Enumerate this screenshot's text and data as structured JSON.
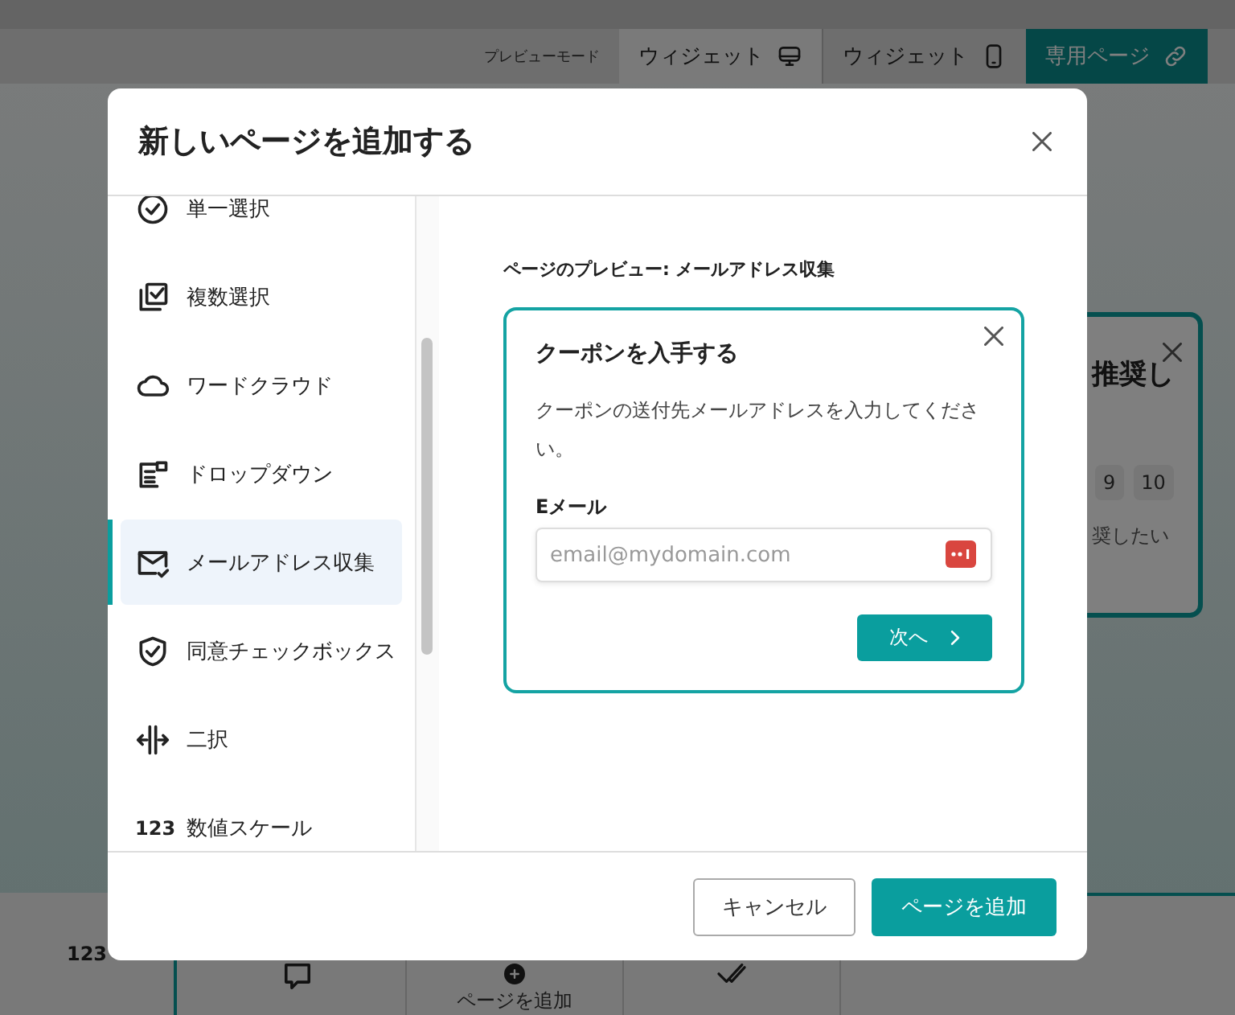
{
  "preview_mode": {
    "label": "プレビューモード",
    "tabs": [
      {
        "label": "ウィジェット",
        "selected": false
      },
      {
        "label": "ウィジェット",
        "selected": false
      },
      {
        "label": "専用ページ",
        "selected": true
      }
    ]
  },
  "background_card": {
    "title": "推奨し",
    "scale": [
      "9",
      "10"
    ],
    "caption": "奨したい"
  },
  "background_footer": {
    "number_icon": "123",
    "add_page_label": "ページを追加"
  },
  "dialog": {
    "title": "新しいページを追加する",
    "page_types": [
      {
        "label": "単一選択",
        "kind": "single",
        "selected": false
      },
      {
        "label": "複数選択",
        "kind": "multiple",
        "selected": false
      },
      {
        "label": "ワードクラウド",
        "kind": "cloud",
        "selected": false
      },
      {
        "label": "ドロップダウン",
        "kind": "dropdown",
        "selected": false
      },
      {
        "label": "メールアドレス収集",
        "kind": "email",
        "selected": true
      },
      {
        "label": "同意チェックボックス",
        "kind": "consent",
        "selected": false
      },
      {
        "label": "二択",
        "kind": "binary",
        "selected": false
      },
      {
        "label": "数値スケール",
        "kind": "number",
        "icon_text": "123",
        "selected": false
      }
    ],
    "preview_label": "ページのプレビュー: メールアドレス収集",
    "preview": {
      "title": "クーポンを入手する",
      "description": "クーポンの送付先メールアドレスを入力してください。",
      "field_label": "Eメール",
      "placeholder": "email@mydomain.com",
      "next_button": "次へ"
    },
    "buttons": {
      "cancel": "キャンセル",
      "add": "ページを追加"
    }
  }
}
